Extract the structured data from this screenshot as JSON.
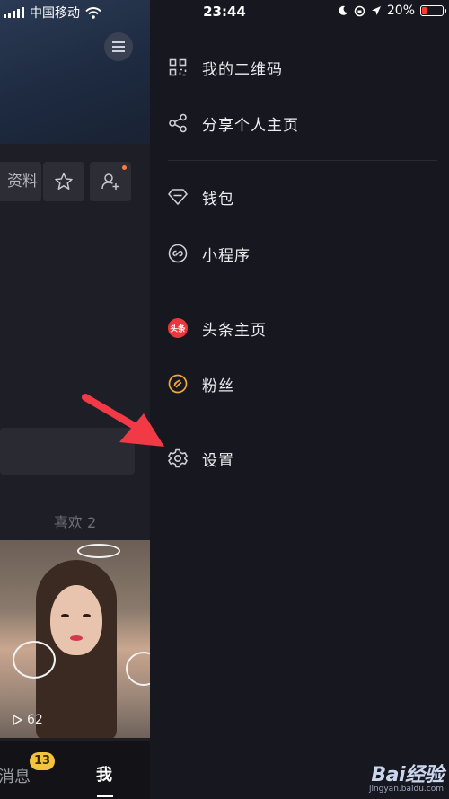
{
  "status_bar": {
    "carrier": "中国移动",
    "time": "23:44",
    "battery": "20%"
  },
  "profile": {
    "edit_label": "资料",
    "likes_tab": "喜欢 2",
    "video_play_count": "62"
  },
  "tabbar": {
    "messages": "消息",
    "messages_badge": "13",
    "me": "我"
  },
  "drawer": {
    "items": [
      {
        "label": "我的二维码",
        "icon": "qr-code-icon"
      },
      {
        "label": "分享个人主页",
        "icon": "share-icon"
      },
      {
        "label": "钱包",
        "icon": "diamond-icon"
      },
      {
        "label": "小程序",
        "icon": "mini-program-icon"
      },
      {
        "label": "头条主页",
        "icon": "toutiao-icon",
        "icon_text": "头条"
      },
      {
        "label": "粉丝",
        "icon": "fans-icon"
      },
      {
        "label": "设置",
        "icon": "gear-icon"
      }
    ]
  },
  "watermark": {
    "brand": "Bai经验",
    "url": "jingyan.baidu.com"
  },
  "colors": {
    "background": "#17171f",
    "accent_badge": "#f3c43b",
    "arrow": "#f23a47",
    "battery_low": "#ff3b30"
  }
}
